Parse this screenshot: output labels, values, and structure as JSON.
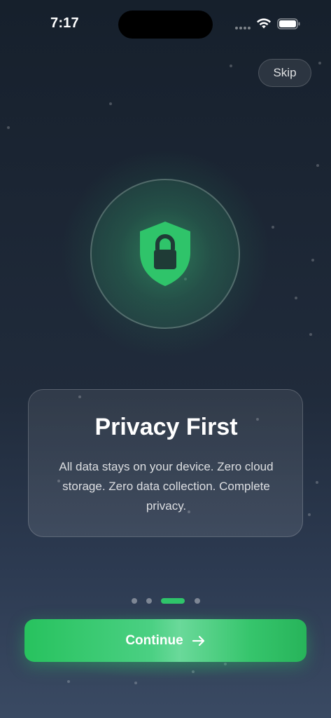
{
  "status_bar": {
    "time": "7:17"
  },
  "skip_label": "Skip",
  "card": {
    "title": "Privacy First",
    "body": "All data stays on your device. Zero cloud storage. Zero data collection. Complete privacy."
  },
  "pagination": {
    "total": 4,
    "active": 3
  },
  "continue_label": "Continue",
  "icons": {
    "hero": "shield-lock-icon",
    "continue": "arrow-right-icon"
  },
  "colors": {
    "accent": "#2fc46a",
    "background_top": "#16202c",
    "background_bottom": "#3a4a63"
  }
}
